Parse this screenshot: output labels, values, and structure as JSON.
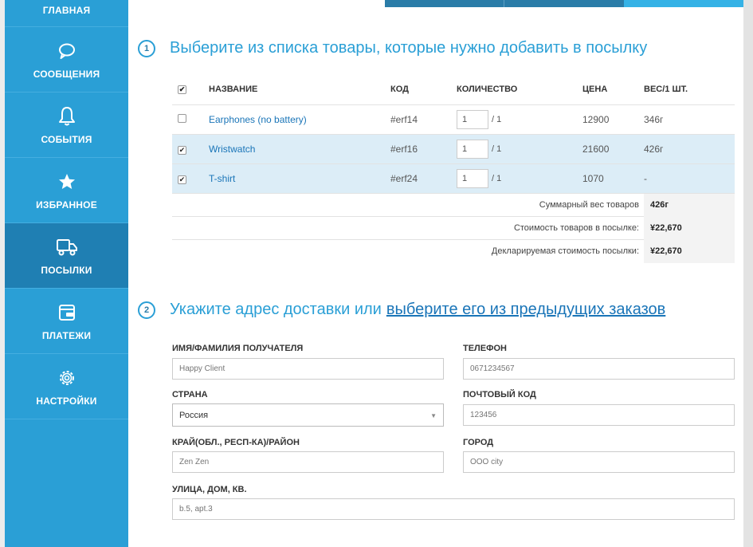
{
  "sidebar": {
    "items": [
      {
        "label": "ГЛАВНАЯ",
        "icon": "home-icon"
      },
      {
        "label": "СООБЩЕНИЯ",
        "icon": "speech-bubble-icon"
      },
      {
        "label": "СОБЫТИЯ",
        "icon": "bell-icon"
      },
      {
        "label": "ИЗБРАННОЕ",
        "icon": "star-icon"
      },
      {
        "label": "ПОСЫЛКИ",
        "icon": "delivery-truck-icon"
      },
      {
        "label": "ПЛАТЕЖИ",
        "icon": "wallet-icon"
      },
      {
        "label": "НАСТРОЙКИ",
        "icon": "gears-icon"
      }
    ],
    "active": "ПОСЫЛКИ"
  },
  "step1": {
    "number": "1",
    "title": "Выберите из списка товары, которые нужно добавить в посылку"
  },
  "table": {
    "headers": {
      "name": "НАЗВАНИЕ",
      "code": "КОД",
      "qty": "КОЛИЧЕСТВО",
      "price": "ЦЕНА",
      "weight": "ВЕС/1 ШТ."
    },
    "rows": [
      {
        "checked": false,
        "name": "Earphones (no battery)",
        "code": "#erf14",
        "qty": "1",
        "max": "/ 1",
        "price": "12900",
        "weight": "346г"
      },
      {
        "checked": true,
        "name": "Wristwatch",
        "code": "#erf16",
        "qty": "1",
        "max": "/ 1",
        "price": "21600",
        "weight": "426г"
      },
      {
        "checked": true,
        "name": "T-shirt",
        "code": "#erf24",
        "qty": "1",
        "max": "/ 1",
        "price": "1070",
        "weight": "-"
      }
    ]
  },
  "summary": {
    "weight_label": "Суммарный вес товаров",
    "weight_value": "426г",
    "cost_label": "Стоимость товаров в посылке:",
    "cost_value": "¥22,670",
    "declared_label": "Декларируемая стоимость посылки:",
    "declared_value": "¥22,670"
  },
  "step2": {
    "number": "2",
    "title": "Укажите адрес доставки или",
    "link": "выберите его из предыдущих заказов"
  },
  "form": {
    "name_label": "ИМЯ/ФАМИЛИЯ ПОЛУЧАТЕЛЯ",
    "name_value": "Happy Client",
    "phone_label": "ТЕЛЕФОН",
    "phone_value": "0671234567",
    "country_label": "СТРАНА",
    "country_value": "Россия",
    "zip_label": "ПОЧТОВЫЙ КОД",
    "zip_value": "123456",
    "region_label": "КРАЙ(ОБЛ., РЕСП-КА)/РАЙОН",
    "region_value": "Zen Zen",
    "city_label": "ГОРОД",
    "city_value": "OOO city",
    "street_label": "УЛИЦА, ДОМ, КВ.",
    "street_value": "b.5, apt.3"
  },
  "colors": {
    "accent": "#2a9fd6",
    "sidebar_active": "#1f7fb3",
    "row_selected": "#dcedf7",
    "link": "#1a75b8"
  }
}
